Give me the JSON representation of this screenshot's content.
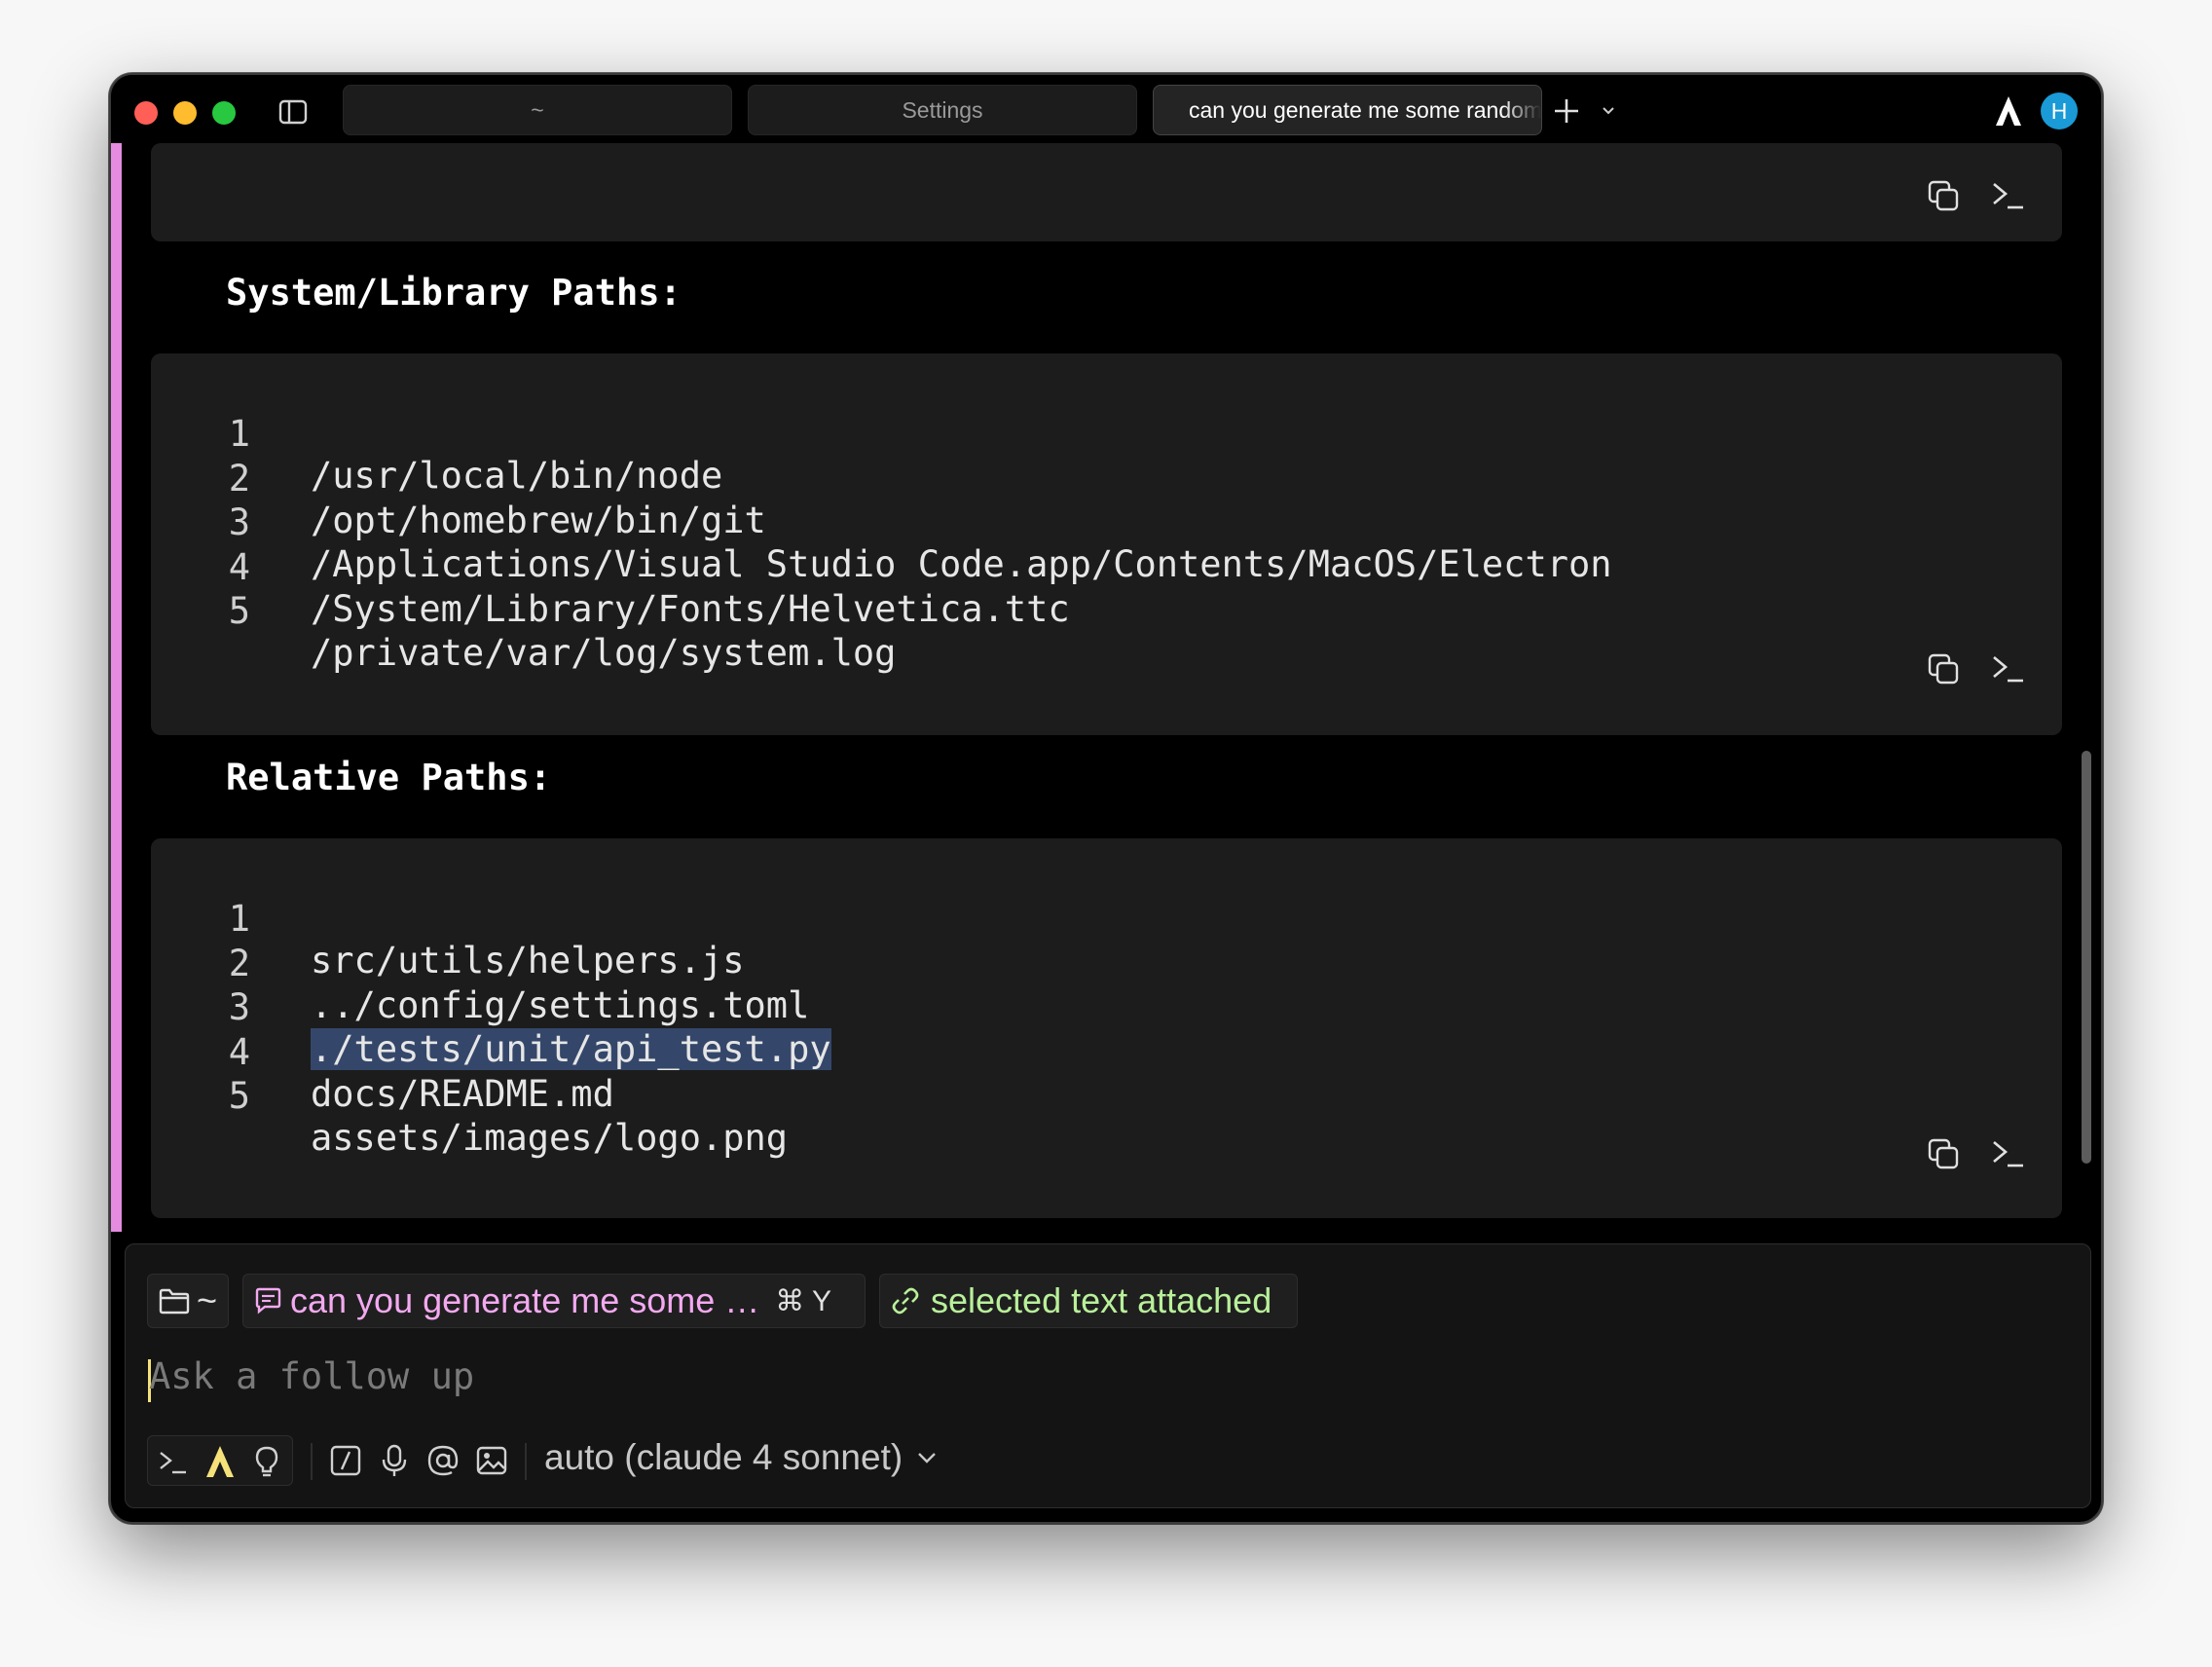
{
  "titlebar": {
    "tabs": [
      {
        "label": "~"
      },
      {
        "label": "Settings"
      },
      {
        "label": "can you generate me some random paths",
        "status": "success-check-icon"
      }
    ],
    "avatar_initial": "H"
  },
  "sections": [
    {
      "heading": "System/Library Paths:",
      "lines": [
        {
          "n": "1",
          "text": "/usr/local/bin/node"
        },
        {
          "n": "2",
          "text": "/opt/homebrew/bin/git"
        },
        {
          "n": "3",
          "text": "/Applications/Visual Studio Code.app/Contents/MacOS/Electron"
        },
        {
          "n": "4",
          "text": "/System/Library/Fonts/Helvetica.ttc"
        },
        {
          "n": "5",
          "text": "/private/var/log/system.log"
        }
      ]
    },
    {
      "heading": "Relative Paths:",
      "lines": [
        {
          "n": "1",
          "text": "src/utils/helpers.js"
        },
        {
          "n": "2",
          "text": "../config/settings.toml"
        },
        {
          "n": "3",
          "text": "./tests/unit/api_test.py",
          "selected": true
        },
        {
          "n": "4",
          "text": "docs/README.md"
        },
        {
          "n": "5",
          "text": "assets/images/logo.png"
        }
      ]
    }
  ],
  "input": {
    "dir_chip": "~",
    "conversation_chip": "can you generate me some …",
    "conversation_shortcut": "⌘ Y",
    "attachment_chip": "selected text attached",
    "placeholder": "Ask a follow up",
    "model": "auto (claude 4 sonnet)"
  },
  "colors": {
    "accent_pink": "#e58be0",
    "chip_conversation": "#f3a9f0",
    "chip_attachment": "#b9f09a",
    "selection": "#34476a",
    "avatar": "#1a9ad6"
  }
}
